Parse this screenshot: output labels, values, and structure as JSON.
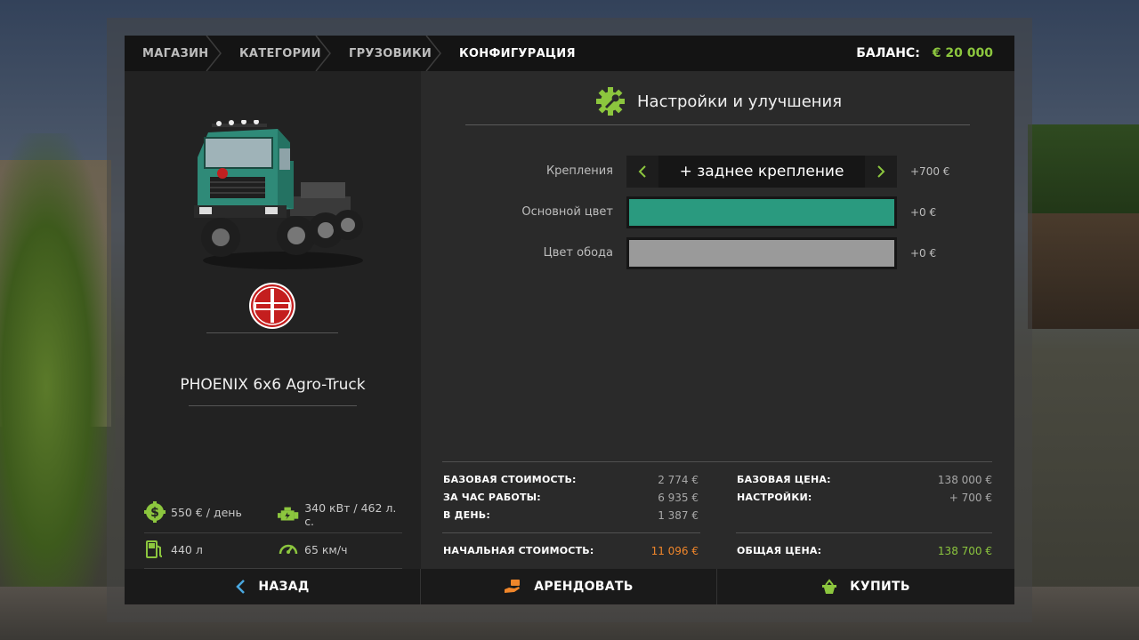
{
  "breadcrumbs": [
    "МАГАЗИН",
    "КАТЕГОРИИ",
    "ГРУЗОВИКИ",
    "КОНФИГУРАЦИЯ"
  ],
  "balance": {
    "label": "БАЛАНС:",
    "value": "€ 20 000"
  },
  "vehicle": {
    "name": "PHOENIX 6x6 Agro-Truck",
    "brand": "TATRA",
    "specs": {
      "daily_cost": "550 € / день",
      "power": "340 кВт / 462 л. с.",
      "fuel": "440 л",
      "speed": "65 км/ч"
    }
  },
  "config": {
    "title": "Настройки и улучшения",
    "rows": [
      {
        "label": "Крепления",
        "value": "+ заднее крепление",
        "price": "+700 €"
      },
      {
        "label": "Основной цвет",
        "price": "+0 €",
        "color": "#2a9a7f"
      },
      {
        "label": "Цвет обода",
        "price": "+0 €",
        "color": "#9a9a9a"
      }
    ]
  },
  "summary": {
    "left": [
      {
        "label": "БАЗОВАЯ СТОИМОСТЬ:",
        "value": "2 774 €"
      },
      {
        "label": "ЗА ЧАС РАБОТЫ:",
        "value": "6 935 €"
      },
      {
        "label": "В ДЕНЬ:",
        "value": "1 387 €"
      }
    ],
    "left_total": {
      "label": "НАЧАЛЬНАЯ СТОИМОСТЬ:",
      "value": "11 096 €"
    },
    "right": [
      {
        "label": "БАЗОВАЯ ЦЕНА:",
        "value": "138 000 €"
      },
      {
        "label": "НАСТРОЙКИ:",
        "value": "+ 700 €"
      }
    ],
    "right_total": {
      "label": "ОБЩАЯ ЦЕНА:",
      "value": "138 700 €"
    }
  },
  "actions": {
    "back": "НАЗАД",
    "lease": "АРЕНДОВАТЬ",
    "buy": "КУПИТЬ"
  },
  "colors": {
    "accent_green": "#8cc63e",
    "accent_orange": "#f0862a"
  }
}
